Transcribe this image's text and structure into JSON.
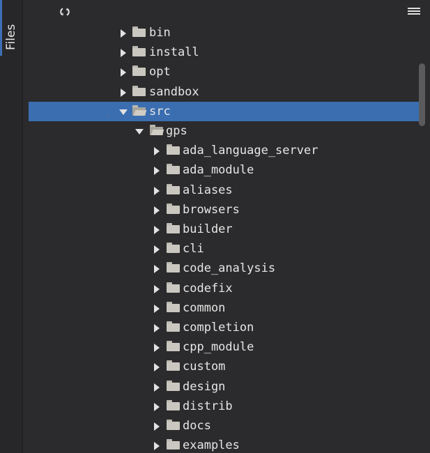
{
  "side_panel": {
    "tab_label": "Files"
  },
  "toolbar": {
    "refresh_icon": "refresh-icon",
    "menu_icon": "hamburger-menu-icon"
  },
  "tree": {
    "rows": [
      {
        "label": "bin",
        "level": 1,
        "expanded": false,
        "selected": false
      },
      {
        "label": "install",
        "level": 1,
        "expanded": false,
        "selected": false
      },
      {
        "label": "opt",
        "level": 1,
        "expanded": false,
        "selected": false
      },
      {
        "label": "sandbox",
        "level": 1,
        "expanded": false,
        "selected": false
      },
      {
        "label": "src",
        "level": 1,
        "expanded": true,
        "selected": true
      },
      {
        "label": "gps",
        "level": 2,
        "expanded": true,
        "selected": false
      },
      {
        "label": "ada_language_server",
        "level": 3,
        "expanded": false,
        "selected": false
      },
      {
        "label": "ada_module",
        "level": 3,
        "expanded": false,
        "selected": false
      },
      {
        "label": "aliases",
        "level": 3,
        "expanded": false,
        "selected": false
      },
      {
        "label": "browsers",
        "level": 3,
        "expanded": false,
        "selected": false
      },
      {
        "label": "builder",
        "level": 3,
        "expanded": false,
        "selected": false
      },
      {
        "label": "cli",
        "level": 3,
        "expanded": false,
        "selected": false
      },
      {
        "label": "code_analysis",
        "level": 3,
        "expanded": false,
        "selected": false
      },
      {
        "label": "codefix",
        "level": 3,
        "expanded": false,
        "selected": false
      },
      {
        "label": "common",
        "level": 3,
        "expanded": false,
        "selected": false
      },
      {
        "label": "completion",
        "level": 3,
        "expanded": false,
        "selected": false
      },
      {
        "label": "cpp_module",
        "level": 3,
        "expanded": false,
        "selected": false
      },
      {
        "label": "custom",
        "level": 3,
        "expanded": false,
        "selected": false
      },
      {
        "label": "design",
        "level": 3,
        "expanded": false,
        "selected": false
      },
      {
        "label": "distrib",
        "level": 3,
        "expanded": false,
        "selected": false
      },
      {
        "label": "docs",
        "level": 3,
        "expanded": false,
        "selected": false
      },
      {
        "label": "examples",
        "level": 3,
        "expanded": false,
        "selected": false
      }
    ]
  },
  "colors": {
    "background": "#2b2b2d",
    "selection": "#3b6eb0",
    "folder": "#c9c7bf",
    "accent": "#3d6fb5"
  }
}
